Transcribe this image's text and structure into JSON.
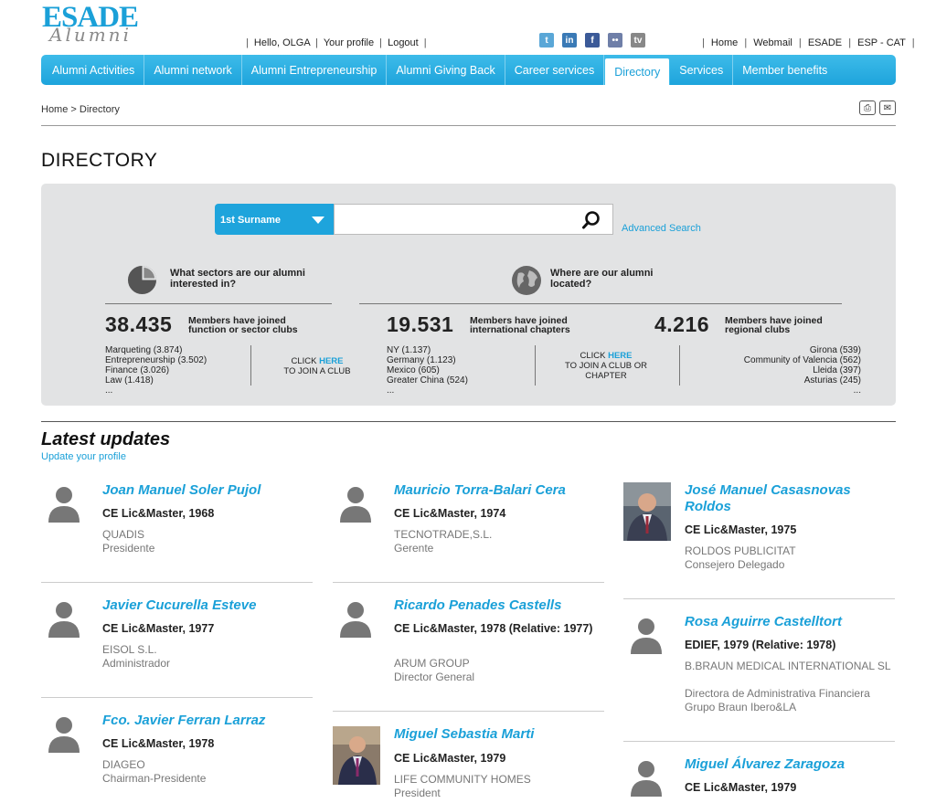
{
  "logo": {
    "main": "ESADE",
    "sub": "Alumni"
  },
  "user_links": {
    "hello": "Hello, OLGA",
    "profile": "Your profile",
    "logout": "Logout"
  },
  "social": [
    {
      "name": "twitter-icon",
      "glyph": "t",
      "color": "#5aa7d7"
    },
    {
      "name": "linkedin-icon",
      "glyph": "in",
      "color": "#3a7ab6"
    },
    {
      "name": "facebook-icon",
      "glyph": "f",
      "color": "#3b5a98"
    },
    {
      "name": "flickr-icon",
      "glyph": "••",
      "color": "#6f7fa8"
    },
    {
      "name": "tv-icon",
      "glyph": "tv",
      "color": "#888888"
    }
  ],
  "top_links": {
    "home": "Home",
    "webmail": "Webmail",
    "esade": "ESADE",
    "lang": "ESP - CAT"
  },
  "nav": [
    "Alumni Activities",
    "Alumni network",
    "Alumni Entrepreneurship",
    "Alumni Giving Back",
    "Career services",
    "Directory",
    "Services",
    "Member benefits"
  ],
  "breadcrumb": "Home > Directory",
  "page_title": "DIRECTORY",
  "search": {
    "select_label": "1st Surname",
    "value": "",
    "advanced": "Advanced Search"
  },
  "q_sectors": "What sectors are our alumni interested in?",
  "q_located": "Where are our alumni located?",
  "stats": [
    {
      "num": "38.435",
      "label": "Members have joined function or sector clubs",
      "list": [
        "Marqueting (3.874)",
        "Entrepreneurship (3.502)",
        "Finance (3.026)",
        "Law (1.418)",
        "..."
      ],
      "join_pre": "CLICK ",
      "join_here": "HERE",
      "join_post": "TO JOIN A CLUB"
    },
    {
      "num": "19.531",
      "label": "Members have joined international chapters",
      "list": [
        "NY (1.137)",
        "Germany (1.123)",
        "Mexico (605)",
        "Greater China (524)",
        "..."
      ],
      "join_pre": "CLICK ",
      "join_here": "HERE",
      "join_post": "TO JOIN A CLUB OR CHAPTER"
    },
    {
      "num": "4.216",
      "label": "Members have joined regional clubs",
      "list": [
        "Girona (539)",
        "Community of Valencia (562)",
        "Lleida (397)",
        "Asturias (245)",
        "..."
      ]
    }
  ],
  "latest_title": "Latest updates",
  "update_profile": "Update your profile",
  "profiles": [
    {
      "name": "Joan Manuel Soler Pujol",
      "program": "CE Lic&Master, 1968",
      "company": "QUADIS",
      "role": "Presidente"
    },
    {
      "name": "Javier Cucurella Esteve",
      "program": "CE Lic&Master, 1977",
      "company": "EISOL S.L.",
      "role": "Administrador"
    },
    {
      "name": "Fco. Javier Ferran Larraz",
      "program": "CE Lic&Master, 1978",
      "company": "DIAGEO",
      "role": "Chairman-Presidente"
    },
    {
      "name": "Mauricio Torra-Balari Cera",
      "program": "CE Lic&Master, 1974",
      "company": "TECNOTRADE,S.L.",
      "role": "Gerente"
    },
    {
      "name": "Ricardo Penades Castells",
      "program": "CE Lic&Master, 1978 (Relative: 1977)",
      "company": "ARUM GROUP",
      "role": "Director General"
    },
    {
      "name": "Miguel Sebastia Marti",
      "program": "CE Lic&Master, 1979",
      "company": "LIFE COMMUNITY HOMES",
      "role": "President"
    },
    {
      "name": "José Manuel Casasnovas Roldos",
      "program": "CE Lic&Master, 1975",
      "company": "ROLDOS PUBLICITAT",
      "role": "Consejero Delegado"
    },
    {
      "name": "Rosa Aguirre Castelltort",
      "program": "EDIEF, 1979 (Relative: 1978)",
      "company": "B.BRAUN MEDICAL INTERNATIONAL SL",
      "role": "Directora de Administrativa Financiera Grupo Braun Ibero&LA"
    },
    {
      "name": "Miguel Álvarez Zaragoza",
      "program": "CE Lic&Master, 1979",
      "company": "",
      "role": ""
    }
  ]
}
